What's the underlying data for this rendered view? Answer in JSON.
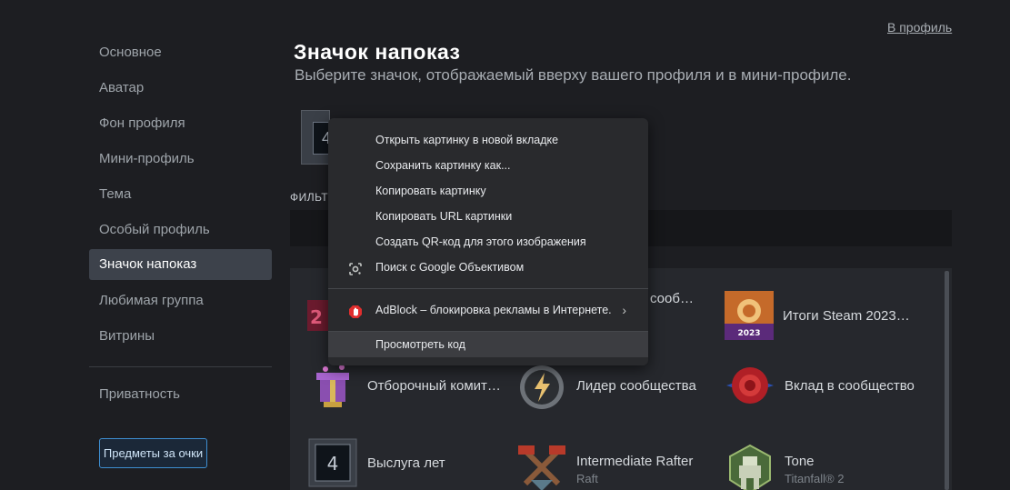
{
  "header": {
    "profile_link": "В профиль"
  },
  "sidebar": {
    "items": [
      {
        "label": "Основное"
      },
      {
        "label": "Аватар"
      },
      {
        "label": "Фон профиля"
      },
      {
        "label": "Мини-профиль"
      },
      {
        "label": "Тема"
      },
      {
        "label": "Особый профиль"
      },
      {
        "label": "Значок напоказ",
        "active": true
      },
      {
        "label": "Любимая группа"
      },
      {
        "label": "Витрины"
      }
    ],
    "privacy": "Приватность",
    "points_button": "Предметы за очки"
  },
  "main": {
    "title": "Значок напоказ",
    "subtitle": "Выберите значок, отображаемый вверху вашего профиля и в мини-профиле.",
    "current_badge_value": "4",
    "filter_label": "ФИЛЬТ",
    "badges": [
      {
        "name": "",
        "sub": "",
        "icon": "pixel-badge-icon"
      },
      {
        "name": "…сооб…",
        "sub": "",
        "icon": "community-badge-icon"
      },
      {
        "name": "Итоги Steam 2023…",
        "sub": "",
        "icon": "steam-2023-icon",
        "icon_text": "2023"
      },
      {
        "name": "Отборочный комит…",
        "sub": "",
        "icon": "gift-box-icon"
      },
      {
        "name": "Лидер сообщества",
        "sub": "",
        "icon": "lightning-medal-icon"
      },
      {
        "name": "Вклад в сообщество",
        "sub": "",
        "icon": "red-seal-icon"
      },
      {
        "name": "Выслуга лет",
        "sub": "",
        "icon": "years-of-service-icon",
        "icon_text": "4"
      },
      {
        "name": "Intermediate Rafter",
        "sub": "Raft",
        "icon": "crossed-hammers-icon"
      },
      {
        "name": "Tone",
        "sub": "Titanfall® 2",
        "icon": "titan-robot-icon"
      }
    ]
  },
  "context_menu": {
    "items": [
      {
        "label": "Открыть картинку в новой вкладке"
      },
      {
        "label": "Сохранить картинку как..."
      },
      {
        "label": "Копировать картинку"
      },
      {
        "label": "Копировать URL картинки"
      },
      {
        "label": "Создать QR-код для этого изображения"
      },
      {
        "label": "Поиск с Google Объективом",
        "icon": "google-lens-icon"
      },
      {
        "label": "AdBlock – блокировка рекламы в Интернете.",
        "icon": "adblock-icon",
        "submenu": true
      },
      {
        "label": "Просмотреть код"
      }
    ]
  },
  "colors": {
    "background": "#1d1e22",
    "active_item": "#3d424b",
    "accent_blue": "#3e8ed0",
    "menu_bg": "#292a2d"
  }
}
